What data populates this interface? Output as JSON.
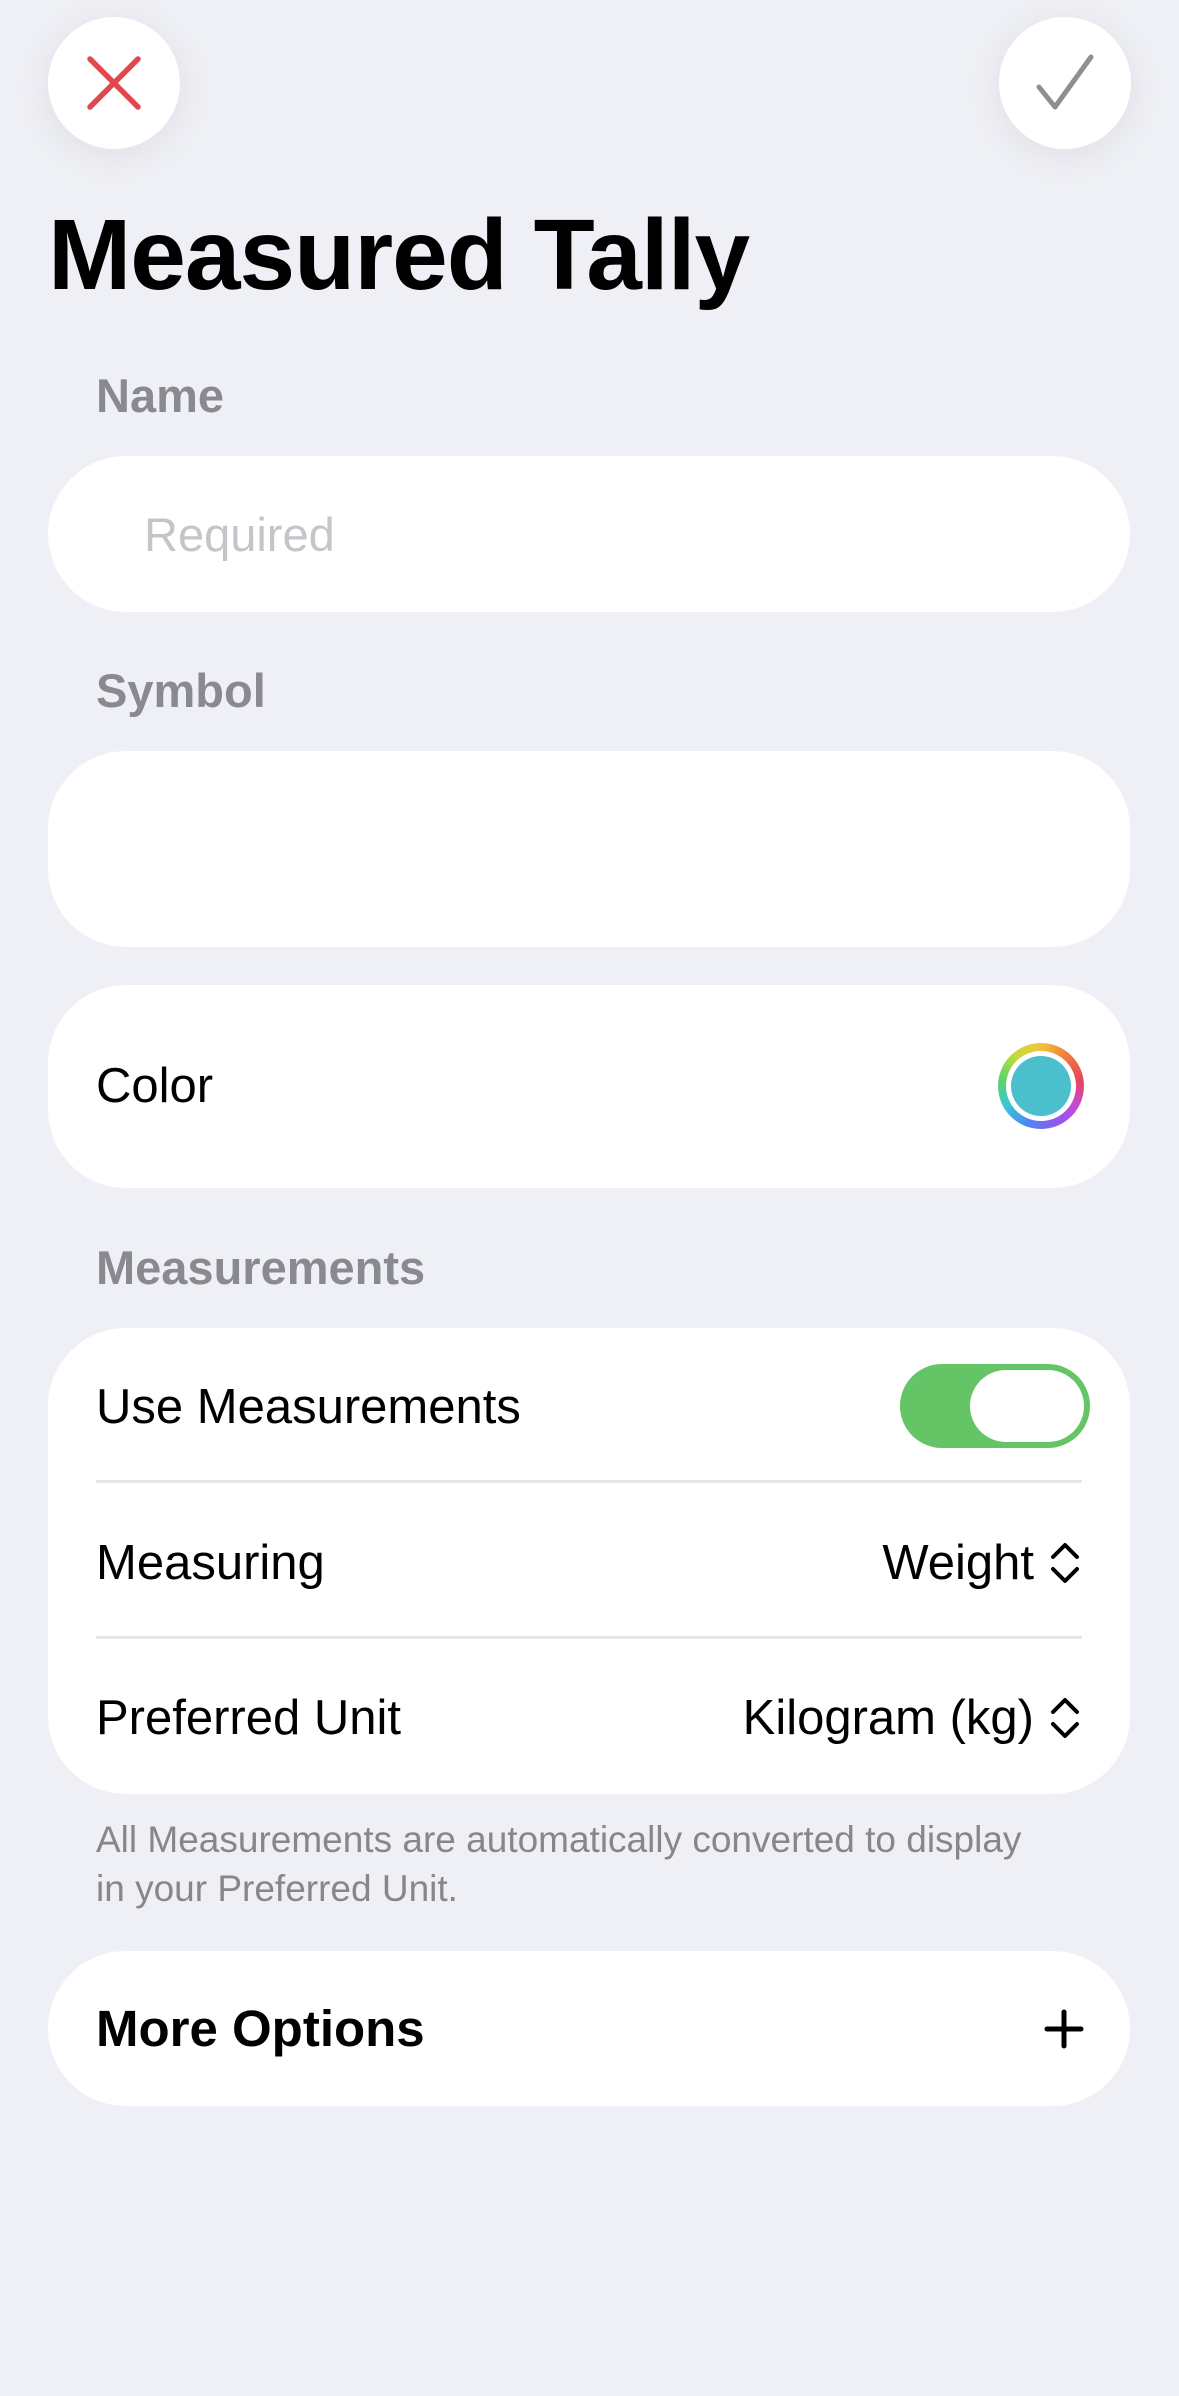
{
  "header": {
    "title": "Measured Tally"
  },
  "name_section": {
    "label": "Name",
    "value": "",
    "placeholder": "Required"
  },
  "symbol_section": {
    "label": "Symbol",
    "value": ""
  },
  "color_row": {
    "label": "Color",
    "selected_color": "#4bbfcc"
  },
  "measurements": {
    "label": "Measurements",
    "use_measurements_label": "Use Measurements",
    "use_measurements_on": true,
    "measuring_label": "Measuring",
    "measuring_value": "Weight",
    "preferred_unit_label": "Preferred Unit",
    "preferred_unit_value": "Kilogram (kg)",
    "footnote": "All Measurements are automatically converted to display in your Preferred Unit."
  },
  "more_options": {
    "label": "More Options"
  },
  "colors": {
    "background": "#eff0f5",
    "close_red": "#e0484e",
    "checkmark_gray": "#8e8e93",
    "toggle_green": "#65c466",
    "secondary_text": "#898990"
  },
  "icons": {
    "close": "close-icon",
    "done": "checkmark-icon",
    "color_well": "color-wheel-icon",
    "stepper": "chevron-up-down-icon",
    "add": "plus-icon"
  }
}
